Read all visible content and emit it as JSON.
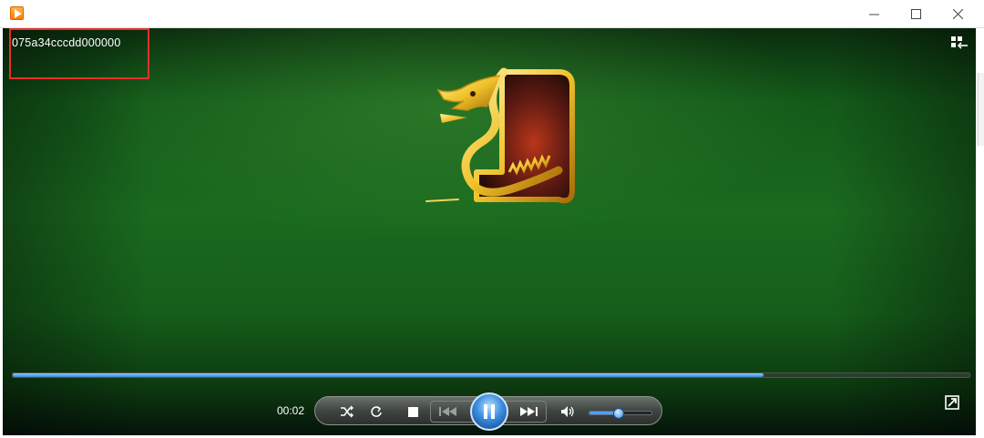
{
  "window": {
    "title": ""
  },
  "video": {
    "overlay_text": "075a34cccdd000000",
    "progress_fraction": 0.785,
    "elapsed_time": "00:02"
  },
  "controls": {
    "volume_fraction": 0.45
  },
  "icons": {
    "app": "media-player-icon",
    "minimize": "minimize-icon",
    "maximize": "maximize-icon",
    "close": "close-icon",
    "switch_layout": "switch-to-library-icon",
    "shuffle": "shuffle-icon",
    "repeat": "repeat-icon",
    "stop": "stop-icon",
    "previous": "previous-icon",
    "pause": "pause-icon",
    "next": "next-icon",
    "volume": "volume-icon",
    "fullscreen": "fullscreen-icon"
  },
  "colors": {
    "highlight_box": "#e8302a",
    "progress_fill": "#3d86d8",
    "video_background": "#1a6a1f"
  }
}
